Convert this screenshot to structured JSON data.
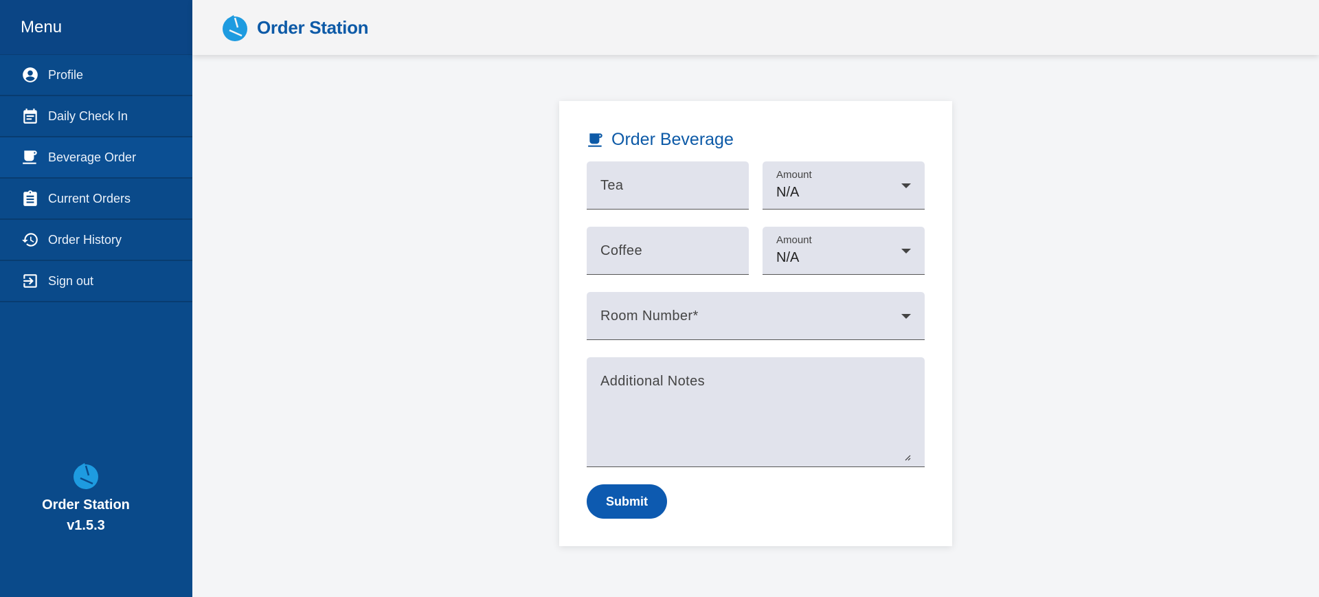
{
  "sidebar": {
    "title": "Menu",
    "items": [
      {
        "label": "Profile",
        "icon": "account-circle-icon"
      },
      {
        "label": "Daily Check In",
        "icon": "calendar-icon"
      },
      {
        "label": "Beverage Order",
        "icon": "coffee-cup-icon",
        "active": true
      },
      {
        "label": "Current Orders",
        "icon": "clipboard-icon"
      },
      {
        "label": "Order History",
        "icon": "history-icon"
      },
      {
        "label": "Sign out",
        "icon": "sign-out-icon"
      }
    ],
    "footer": {
      "app_name": "Order Station",
      "version": "v1.5.3"
    }
  },
  "topbar": {
    "title": "Order Station"
  },
  "form": {
    "title": "Order Beverage",
    "tea": {
      "placeholder": "Tea"
    },
    "tea_amount": {
      "label": "Amount",
      "value": "N/A"
    },
    "coffee": {
      "placeholder": "Coffee"
    },
    "coffee_amount": {
      "label": "Amount",
      "value": "N/A"
    },
    "room_number": {
      "placeholder": "Room Number*"
    },
    "notes": {
      "placeholder": "Additional Notes"
    },
    "submit_label": "Submit"
  },
  "colors": {
    "sidebar_bg": "#0a4a8a",
    "brand_blue": "#0d5aa7",
    "logo_light_blue": "#1e9be0",
    "field_bg": "#e1e3ec",
    "button_bg": "#0d5ab0"
  }
}
